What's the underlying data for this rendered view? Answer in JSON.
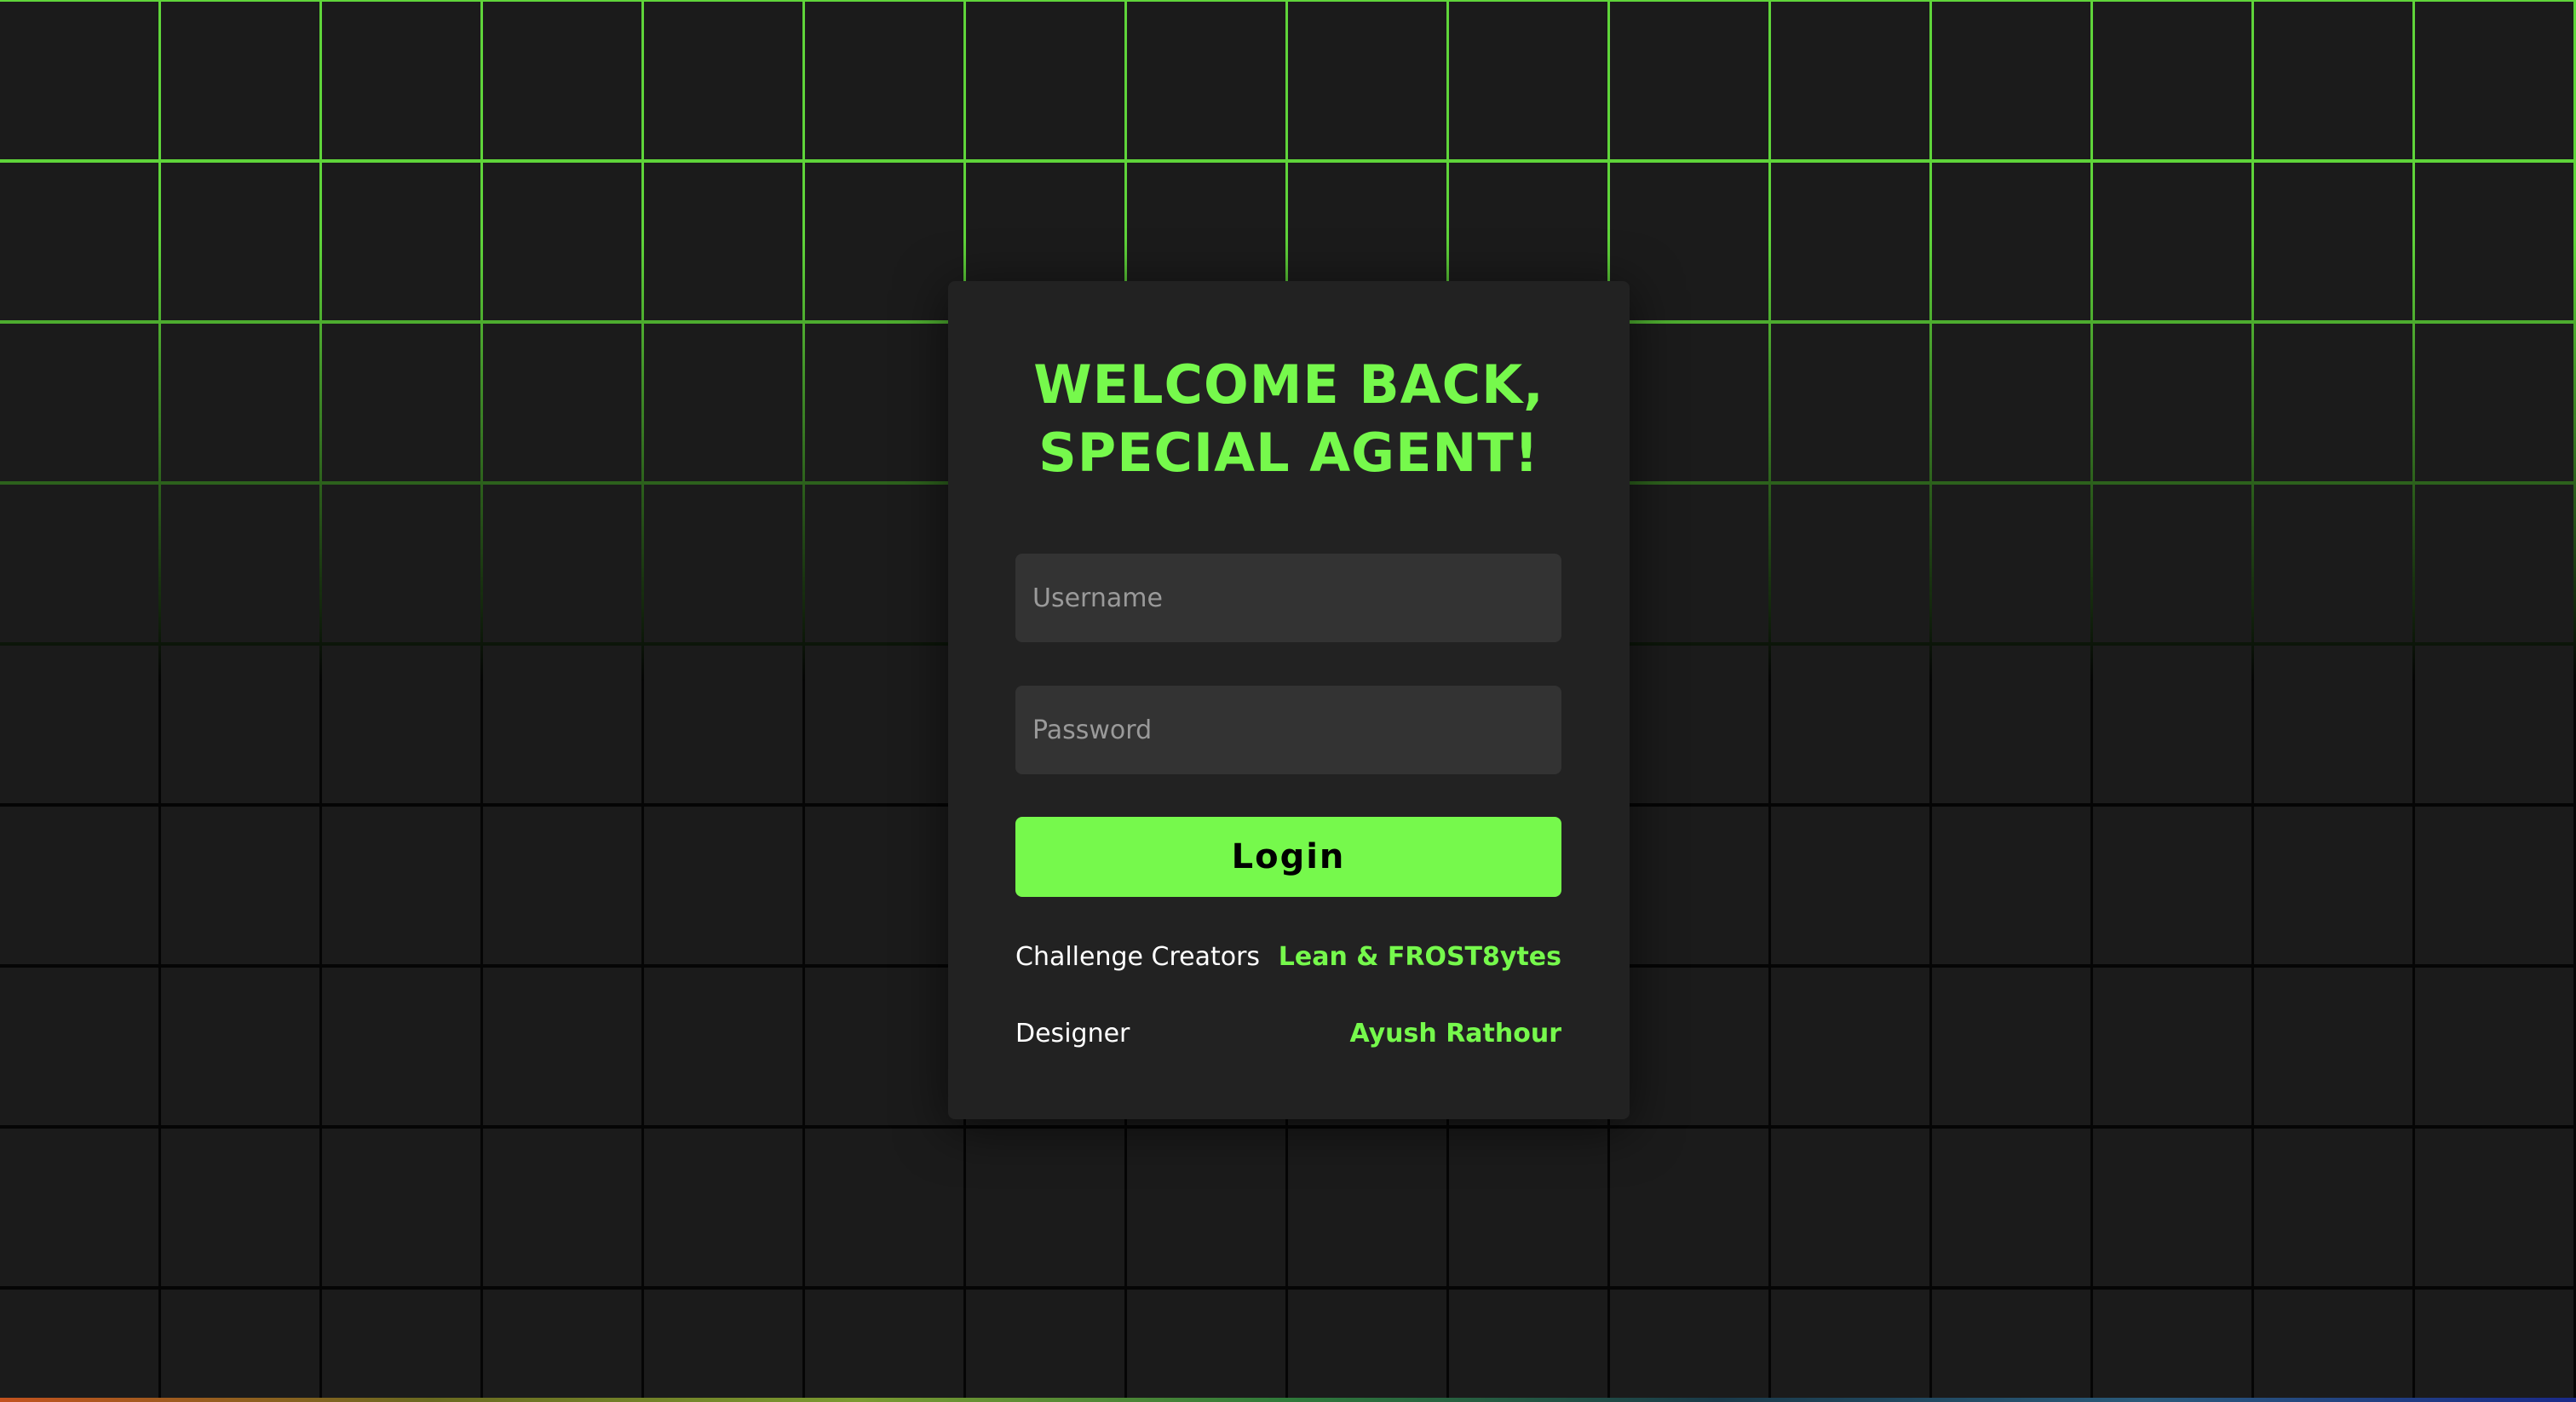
{
  "login": {
    "title_line1": "WELCOME BACK,",
    "title_line2": "SPECIAL AGENT!",
    "username_placeholder": "Username",
    "password_placeholder": "Password",
    "login_label": "Login"
  },
  "credits": [
    {
      "label": "Challenge Creators",
      "value": "Lean & FROST8ytes"
    },
    {
      "label": "Designer",
      "value": "Ayush Rathour"
    }
  ],
  "colors": {
    "accent": "#76f94c",
    "card": "#222222",
    "background": "#1b1b1b",
    "input": "#333333"
  }
}
